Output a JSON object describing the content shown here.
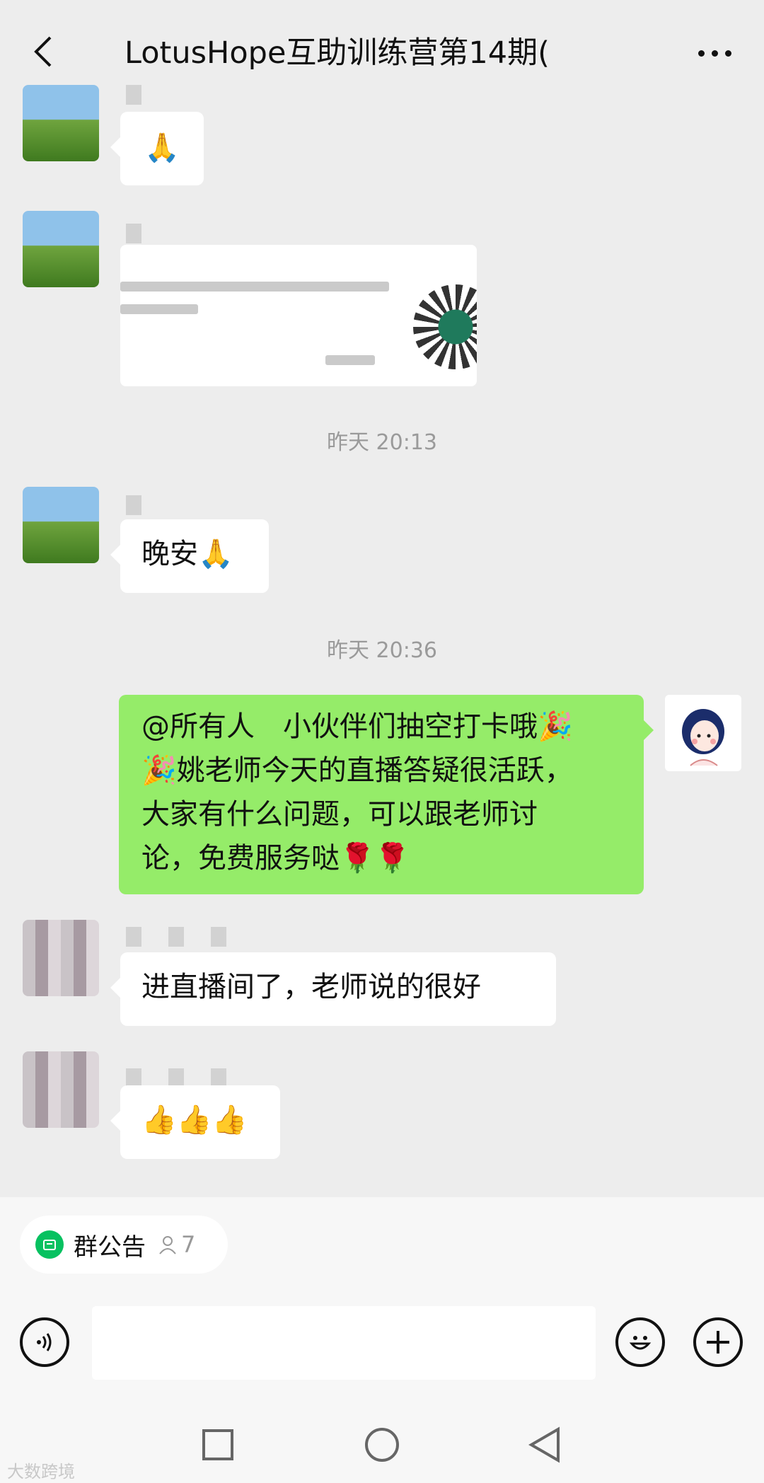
{
  "header": {
    "title": "LotusHope互助训练营第14期(",
    "back_icon": "chevron-left-icon",
    "more_icon": "ellipsis-icon"
  },
  "messages": [
    {
      "sender": "",
      "type": "emoji",
      "content": "🙏"
    },
    {
      "sender": "",
      "type": "card"
    },
    {
      "type": "timestamp",
      "content": "昨天 20:13"
    },
    {
      "sender": "",
      "type": "text",
      "content": "晚安🙏"
    },
    {
      "type": "timestamp",
      "content": "昨天 20:36"
    },
    {
      "sender": "self",
      "type": "text",
      "lines": [
        "@所有人　小伙伴们抽空打卡哦🎉",
        "🎉姚老师今天的直播答疑很活跃，",
        "大家有什么问题，可以跟老师讨",
        "论，免费服务哒🌹🌹"
      ]
    },
    {
      "sender": "",
      "type": "text",
      "content": "进直播间了，老师说的很好"
    },
    {
      "sender": "",
      "type": "emoji",
      "content": "👍👍👍"
    }
  ],
  "notice": {
    "label": "群公告",
    "count": "7",
    "icon": "announcement-icon",
    "count_icon": "person-icon"
  },
  "input_bar": {
    "voice_icon": "voice-icon",
    "emoji_icon": "smiley-icon",
    "plus_icon": "plus-icon"
  },
  "navigation": {
    "square_icon": "recent-apps-icon",
    "circle_icon": "home-icon",
    "triangle_icon": "back-triangle-icon"
  },
  "watermark": "大数跨境",
  "colors": {
    "background": "#ededed",
    "self_bubble": "#95ec69",
    "accent": "#07c160"
  }
}
